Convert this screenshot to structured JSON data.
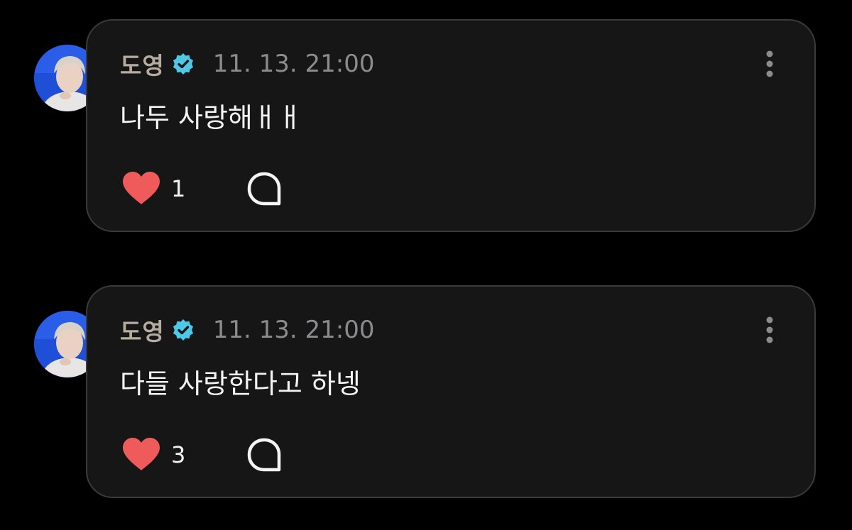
{
  "posts": [
    {
      "author": "도영",
      "time": "11. 13. 21:00",
      "text": "나두 사랑해ㅐㅐ",
      "likes": "1"
    },
    {
      "author": "도영",
      "time": "11. 13. 21:00",
      "text": "다들 사랑한다고 하넹",
      "likes": "3"
    }
  ],
  "icons": {
    "verified": "verified-badge-icon",
    "like": "heart-icon",
    "comment": "comment-bubble-icon",
    "more": "more-vertical-icon"
  },
  "colors": {
    "background": "#000000",
    "card": "#161617",
    "card_border": "#3a3a3c",
    "author": "#b5ab9e",
    "time": "#8c8c8e",
    "text": "#f4f4f4",
    "verified": "#4fc7e8",
    "heart": "#ef5b5b",
    "avatar_bg": "#1f4fd6"
  }
}
